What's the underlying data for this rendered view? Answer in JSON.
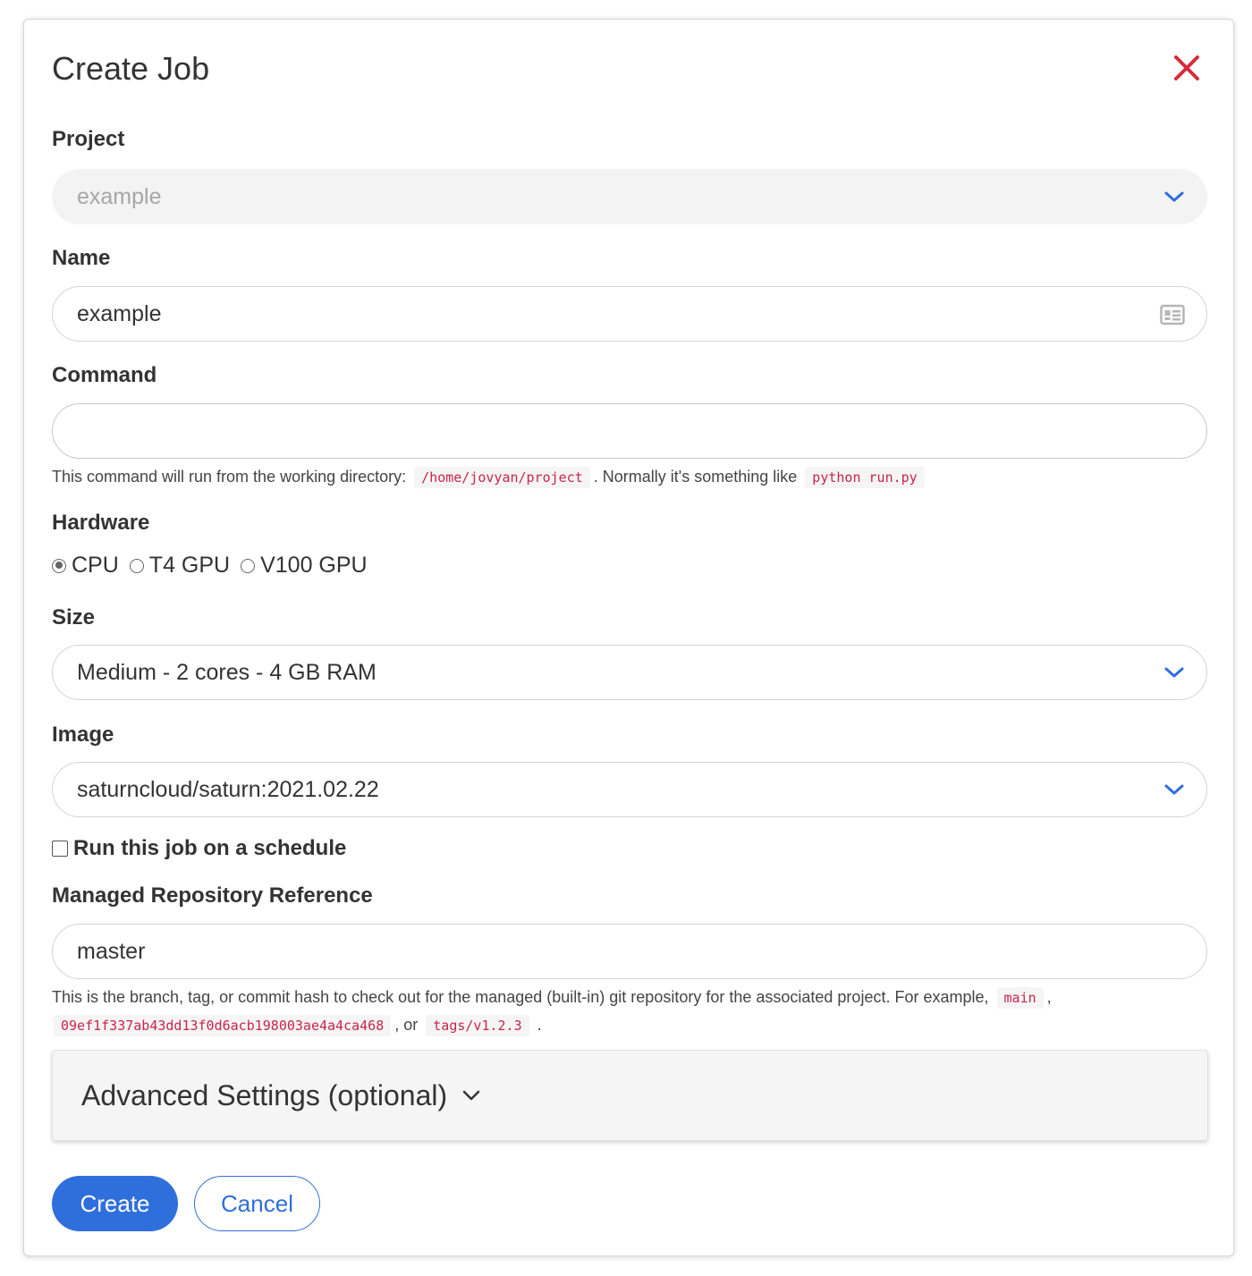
{
  "dialog": {
    "title": "Create Job",
    "close_icon": "close-icon",
    "accent_color": "#2f6fdb",
    "close_color": "#d62d3c"
  },
  "project": {
    "label": "Project",
    "value": "example"
  },
  "name": {
    "label": "Name",
    "value": "example",
    "icon": "contact-card-icon"
  },
  "command": {
    "label": "Command",
    "value": "",
    "help_prefix": "This command will run from the working directory:",
    "help_dir": "/home/jovyan/project",
    "help_middle": ". Normally it's something like",
    "help_example": "python run.py"
  },
  "hardware": {
    "label": "Hardware",
    "options": [
      "CPU",
      "T4 GPU",
      "V100 GPU"
    ],
    "selected": "CPU"
  },
  "size": {
    "label": "Size",
    "value": "Medium - 2 cores - 4 GB RAM"
  },
  "image": {
    "label": "Image",
    "value": "saturncloud/saturn:2021.02.22"
  },
  "schedule": {
    "label": "Run this job on a schedule",
    "checked": false
  },
  "repo": {
    "label": "Managed Repository Reference",
    "value": "master",
    "help_prefix": "This is the branch, tag, or commit hash to check out for the managed (built-in) git repository for the associated project. For example,",
    "example_1": "main",
    "sep_1": ",",
    "example_2": "09ef1f337ab43dd13f0d6acb198003ae4a4ca468",
    "sep_2": ", or",
    "example_3": "tags/v1.2.3",
    "end": "."
  },
  "advanced": {
    "label": "Advanced Settings (optional)"
  },
  "actions": {
    "create_label": "Create",
    "cancel_label": "Cancel"
  }
}
